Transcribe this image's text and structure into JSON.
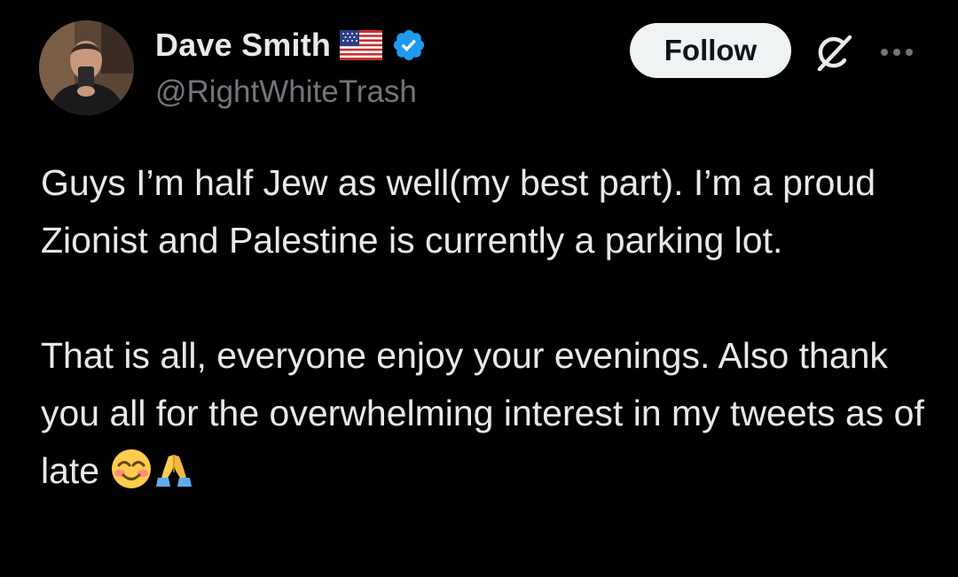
{
  "author": {
    "display_name": "Dave Smith",
    "handle": "@RightWhiteTrash",
    "flag_icon": "us-flag-icon",
    "verified_icon": "verified-badge-icon",
    "verified_color": "#1d9bf0"
  },
  "actions": {
    "follow_label": "Follow",
    "grok_icon": "grok-icon",
    "more_icon": "more-options-icon"
  },
  "tweet": {
    "paragraph_1": "Guys I’m half Jew as well(my best part). I’m a proud Zionist and Palestine is currently a parking lot.",
    "paragraph_2_text": "That is all, everyone enjoy your evenings. Also thank you all for the overwhelming interest in my tweets as of late ",
    "emojis": [
      "smiling-face-icon",
      "folded-hands-icon"
    ]
  },
  "colors": {
    "background": "#000000",
    "text": "#e7e9ea",
    "secondary_text": "#71767b",
    "follow_bg": "#eff3f4"
  }
}
